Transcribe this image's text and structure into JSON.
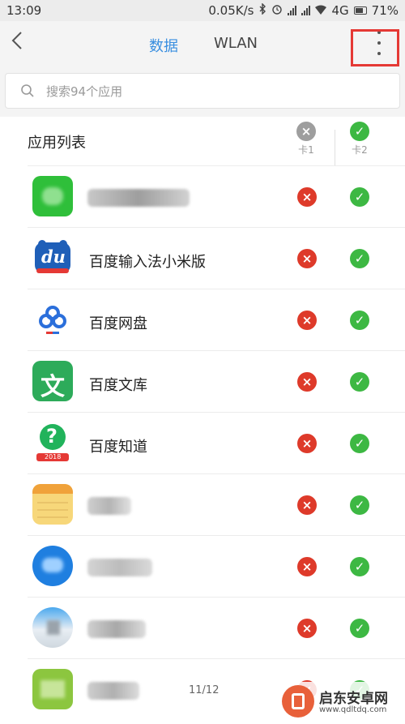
{
  "status_bar": {
    "time": "13:09",
    "speed": "0.05K/s",
    "network": "4G",
    "battery": "71%",
    "icons": [
      "bluetooth-icon",
      "alarm-icon",
      "signal-icon",
      "signal-icon",
      "wifi-icon",
      "battery-icon"
    ]
  },
  "header": {
    "back_icon": "chevron-left-icon",
    "tabs": [
      {
        "label": "数据",
        "active": true
      },
      {
        "label": "WLAN",
        "active": false
      }
    ],
    "more_icon": "more-vertical-icon",
    "annotation_color": "#e53935"
  },
  "search": {
    "placeholder": "搜索94个应用",
    "value": "",
    "icon": "search-icon"
  },
  "list": {
    "title": "应用列表",
    "columns": [
      {
        "label": "卡1",
        "icon": "x-circle-grey-icon"
      },
      {
        "label": "卡2",
        "icon": "check-circle-green-icon"
      }
    ],
    "items": [
      {
        "name": "",
        "sim1": "blocked",
        "sim2": "allowed"
      },
      {
        "name": "百度输入法小米版",
        "sim1": "blocked",
        "sim2": "allowed"
      },
      {
        "name": "百度网盘",
        "sim1": "blocked",
        "sim2": "allowed"
      },
      {
        "name": "百度文库",
        "sim1": "blocked",
        "sim2": "allowed"
      },
      {
        "name": "百度知道",
        "sim1": "blocked",
        "sim2": "allowed"
      },
      {
        "name": "",
        "sim1": "blocked",
        "sim2": "allowed"
      },
      {
        "name": "",
        "sim1": "blocked",
        "sim2": "allowed"
      },
      {
        "name": "",
        "sim1": "blocked",
        "sim2": "allowed"
      },
      {
        "name": "",
        "sim1": "blocked",
        "sim2": "allowed"
      }
    ]
  },
  "icon_text": {
    "baidu_input": "du",
    "wenku": "文",
    "zhidao": "?",
    "zhidao_year": "2018"
  },
  "pager": "11/12",
  "watermark": {
    "title": "启东安卓网",
    "url": "www.qdltdq.com"
  },
  "colors": {
    "accent": "#3a8fe0",
    "blocked": "#de3a2a",
    "allowed": "#3db843"
  }
}
